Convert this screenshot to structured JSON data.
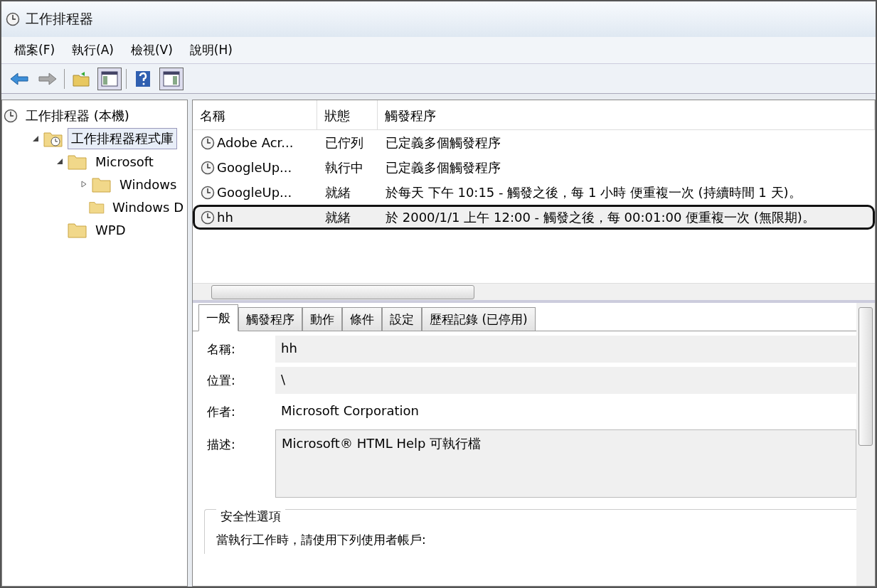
{
  "window": {
    "title": "工作排程器"
  },
  "menu": [
    "檔案(F)",
    "執行(A)",
    "檢視(V)",
    "說明(H)"
  ],
  "tree": [
    {
      "label": "工作排程器 (本機)",
      "kind": "root",
      "selected": false,
      "children": [
        {
          "label": "工作排程器程式庫",
          "kind": "library",
          "expanded": true,
          "selected": true,
          "children": [
            {
              "label": "Microsoft",
              "kind": "folder",
              "expanded": true,
              "selected": false,
              "children": [
                {
                  "label": "Windows",
                  "kind": "folder",
                  "expanded": false,
                  "selected": false
                },
                {
                  "label": "Windows D",
                  "kind": "folder",
                  "selected": false
                }
              ]
            },
            {
              "label": "WPD",
              "kind": "folder",
              "selected": false
            }
          ]
        }
      ]
    }
  ],
  "table": {
    "columns": [
      "名稱",
      "狀態",
      "觸發程序"
    ],
    "rows": [
      {
        "name": "Adobe Acr...",
        "status": "已佇列",
        "trigger": "已定義多個觸發程序",
        "highlighted": false
      },
      {
        "name": "GoogleUp...",
        "status": "執行中",
        "trigger": "已定義多個觸發程序",
        "highlighted": false
      },
      {
        "name": "GoogleUp...",
        "status": "就緒",
        "trigger": "於每天 下午 10:15 - 觸發之後，每 1 小時 便重複一次 (持續時間 1 天)。",
        "highlighted": false
      },
      {
        "name": "hh",
        "status": "就緒",
        "trigger": "於 2000/1/1 上午 12:00 - 觸發之後，每 00:01:00 便重複一次 (無限期)。",
        "highlighted": true
      }
    ]
  },
  "tabs": [
    {
      "label": "一般",
      "selected": true
    },
    {
      "label": "觸發程序",
      "selected": false
    },
    {
      "label": "動作",
      "selected": false
    },
    {
      "label": "條件",
      "selected": false
    },
    {
      "label": "設定",
      "selected": false
    },
    {
      "label": "歷程記錄 (已停用)",
      "selected": false
    }
  ],
  "fields": [
    {
      "label": "名稱:",
      "value": "hh",
      "kind": "field"
    },
    {
      "label": "位置:",
      "value": "\\",
      "kind": "field"
    },
    {
      "label": "作者:",
      "value": "Microsoft Corporation",
      "kind": "plain"
    },
    {
      "label": "描述:",
      "value": "Microsoft® HTML Help 可執行檔",
      "kind": "area"
    }
  ],
  "security": {
    "title": "安全性選項",
    "text": "當執行工作時，請使用下列使用者帳戶:"
  }
}
